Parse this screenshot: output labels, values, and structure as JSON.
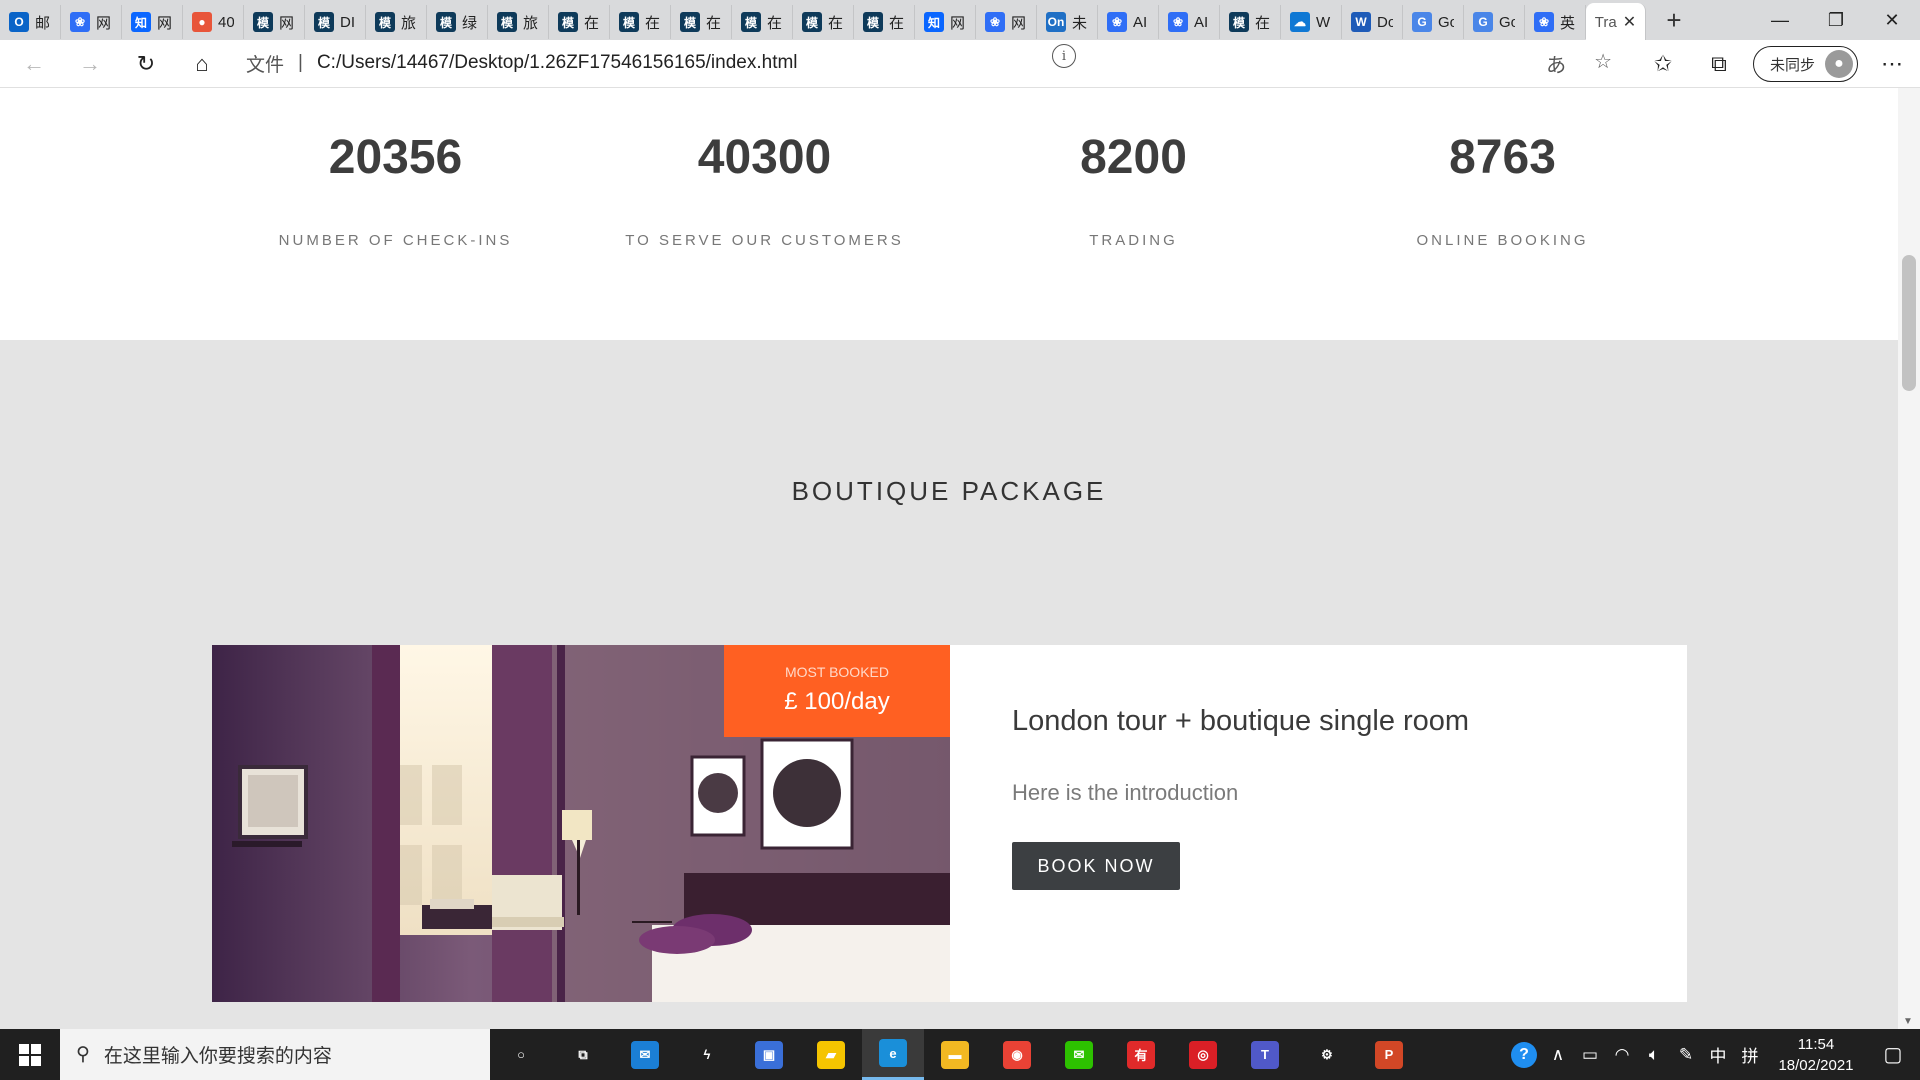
{
  "browser": {
    "tabs": [
      {
        "icon": "outlook-icon",
        "color": "#0a64c8",
        "glyph": "O",
        "title": "邮"
      },
      {
        "icon": "baidu-paw-icon",
        "color": "#2f6ef6",
        "glyph": "❀",
        "title": "网"
      },
      {
        "icon": "zhihu-icon",
        "color": "#0a66ff",
        "glyph": "知",
        "title": "网"
      },
      {
        "icon": "colorful-circle-icon",
        "color": "#e8553a",
        "glyph": "●",
        "title": "40"
      },
      {
        "icon": "template-mo-icon",
        "color": "#0e3a5a",
        "glyph": "模",
        "title": "网"
      },
      {
        "icon": "template-mo-icon",
        "color": "#0e3a5a",
        "glyph": "模",
        "title": "DI"
      },
      {
        "icon": "template-mo-icon",
        "color": "#0e3a5a",
        "glyph": "模",
        "title": "旅"
      },
      {
        "icon": "template-mo-icon",
        "color": "#0e3a5a",
        "glyph": "模",
        "title": "绿"
      },
      {
        "icon": "template-mo-icon",
        "color": "#0e3a5a",
        "glyph": "模",
        "title": "旅"
      },
      {
        "icon": "template-mo-icon",
        "color": "#0e3a5a",
        "glyph": "模",
        "title": "在"
      },
      {
        "icon": "template-mo-icon",
        "color": "#0e3a5a",
        "glyph": "模",
        "title": "在"
      },
      {
        "icon": "template-mo-icon",
        "color": "#0e3a5a",
        "glyph": "模",
        "title": "在"
      },
      {
        "icon": "template-mo-icon",
        "color": "#0e3a5a",
        "glyph": "模",
        "title": "在"
      },
      {
        "icon": "template-mo-icon",
        "color": "#0e3a5a",
        "glyph": "模",
        "title": "在"
      },
      {
        "icon": "template-mo-icon",
        "color": "#0e3a5a",
        "glyph": "模",
        "title": "在"
      },
      {
        "icon": "zhihu-icon",
        "color": "#0a66ff",
        "glyph": "知",
        "title": "网"
      },
      {
        "icon": "baidu-paw-icon",
        "color": "#2f6ef6",
        "glyph": "❀",
        "title": "网"
      },
      {
        "icon": "onenote-icon",
        "color": "#1f6fc5",
        "glyph": "On",
        "title": "未"
      },
      {
        "icon": "baidu-paw-icon",
        "color": "#2f6ef6",
        "glyph": "❀",
        "title": "AI"
      },
      {
        "icon": "baidu-paw-icon",
        "color": "#2f6ef6",
        "glyph": "❀",
        "title": "AI"
      },
      {
        "icon": "template-mo-icon",
        "color": "#0e3a5a",
        "glyph": "模",
        "title": "在"
      },
      {
        "icon": "onedrive-cloud-icon",
        "color": "#0f78d4",
        "glyph": "☁",
        "title": "W"
      },
      {
        "icon": "word-icon",
        "color": "#1e5bb8",
        "glyph": "W",
        "title": "Do"
      },
      {
        "icon": "google-translate-icon",
        "color": "#4a86e8",
        "glyph": "G",
        "title": "Go"
      },
      {
        "icon": "google-translate-icon",
        "color": "#4a86e8",
        "glyph": "G",
        "title": "Go"
      },
      {
        "icon": "baidu-paw-icon",
        "color": "#2f6ef6",
        "glyph": "❀",
        "title": "英"
      }
    ],
    "active_tab": {
      "title": "Tra"
    },
    "address": {
      "protocol_label": "文件",
      "url": "C:/Users/14467/Desktop/1.26ZF17546156165/index.html"
    },
    "profile_label": "未同步"
  },
  "stats": [
    {
      "number": "20356",
      "label": "NUMBER OF CHECK-INS"
    },
    {
      "number": "40300",
      "label": "TO SERVE OUR CUSTOMERS"
    },
    {
      "number": "8200",
      "label": "TRADING"
    },
    {
      "number": "8763",
      "label": "ONLINE BOOKING"
    }
  ],
  "package": {
    "section_title": "BOUTIQUE PACKAGE",
    "badge_label": "MOST BOOKED",
    "price": "£ 100/day",
    "card_title": "London tour + boutique single room",
    "card_intro": "Here is the introduction",
    "button_label": "BOOK NOW"
  },
  "taskbar": {
    "search_placeholder": "在这里输入你要搜索的内容",
    "apps": [
      {
        "icon": "cortana-circle-icon",
        "glyph": "○",
        "color": "transparent"
      },
      {
        "icon": "task-view-icon",
        "glyph": "⧉",
        "color": "transparent"
      },
      {
        "icon": "mail-icon",
        "glyph": "✉",
        "color": "#1b7fd6"
      },
      {
        "icon": "bolt-app-icon",
        "glyph": "ϟ",
        "color": "transparent"
      },
      {
        "icon": "store-icon",
        "glyph": "▣",
        "color": "#3a6fd8"
      },
      {
        "icon": "sticky-notes-icon",
        "glyph": "▰",
        "color": "#f5c400"
      },
      {
        "icon": "edge-icon",
        "glyph": "e",
        "color": "#1a8fd9"
      },
      {
        "icon": "file-explorer-icon",
        "glyph": "▬",
        "color": "#f2b822"
      },
      {
        "icon": "chrome-icon",
        "glyph": "◉",
        "color": "#e94235"
      },
      {
        "icon": "wechat-icon",
        "glyph": "✉",
        "color": "#2dc100"
      },
      {
        "icon": "youdao-icon",
        "glyph": "有",
        "color": "#e02a2a"
      },
      {
        "icon": "creative-cloud-icon",
        "glyph": "◎",
        "color": "#da1f26"
      },
      {
        "icon": "teams-icon",
        "glyph": "T",
        "color": "#5059c9"
      },
      {
        "icon": "settings-gear-icon",
        "glyph": "⚙",
        "color": "transparent"
      },
      {
        "icon": "powerpoint-icon",
        "glyph": "P",
        "color": "#d24726"
      }
    ],
    "tray_lang": "中",
    "tray_ime": "拼",
    "time": "11:54",
    "date": "18/02/2021"
  }
}
